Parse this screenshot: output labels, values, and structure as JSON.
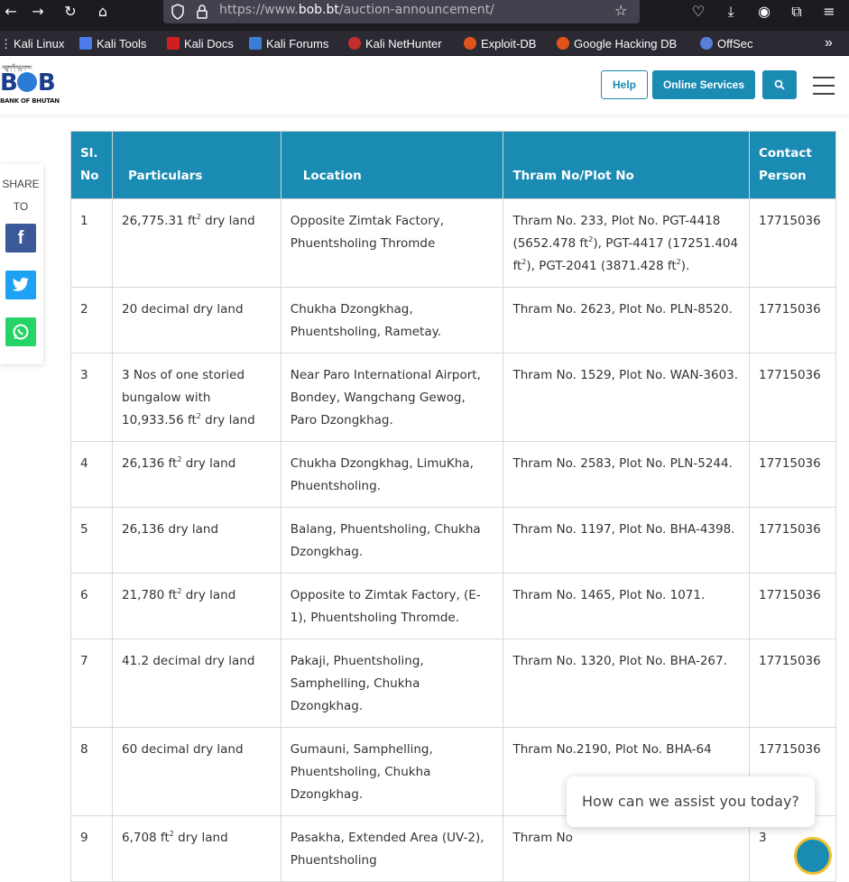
{
  "browser": {
    "url_prefix": "https://www.",
    "url_domain": "bob.bt",
    "url_path": "/auction-announcement/",
    "bookmarks": [
      {
        "label": "Kali Linux",
        "color": "#367bf0"
      },
      {
        "label": "Kali Tools",
        "color": "#4a7be8"
      },
      {
        "label": "Kali Docs",
        "color": "#d11f1f"
      },
      {
        "label": "Kali Forums",
        "color": "#3d7cd6"
      },
      {
        "label": "Kali NetHunter",
        "color": "#c22e2e"
      },
      {
        "label": "Exploit-DB",
        "color": "#e0541c"
      },
      {
        "label": "Google Hacking DB",
        "color": "#e0541c"
      },
      {
        "label": "OffSec",
        "color": "#5b7fd8"
      }
    ]
  },
  "site": {
    "logo_text": "BOB",
    "logo_sub": "BANK OF BHUTAN",
    "logo_top": "འབྲུག་གི་དངུལ་ཁང་",
    "help_label": "Help",
    "online_services_label": "Online Services",
    "brand_color": "#1a8bb3"
  },
  "share": {
    "label": "SHARE TO",
    "facebook_color": "#3b5998",
    "twitter_color": "#1da1f2",
    "whatsapp_color": "#25d366"
  },
  "table": {
    "headers": [
      "Sl. No",
      "Particulars",
      "Location",
      "Thram No/Plot No",
      "Contact Person"
    ],
    "rows": [
      {
        "no": "1",
        "particulars": "26,775.31 ft² dry land",
        "location": "Opposite Zimtak Factory, Phuentsholing Thromde",
        "thram": "Thram No. 233, Plot No. PGT-4418 (5652.478 ft²), PGT-4417 (17251.404 ft²), PGT-2041 (3871.428 ft²).",
        "contact": "17715036"
      },
      {
        "no": "2",
        "particulars": "20 decimal dry land",
        "location": "Chukha Dzongkhag, Phuentsholing, Rametay.",
        "thram": "Thram No. 2623, Plot No. PLN-8520.",
        "contact": "17715036"
      },
      {
        "no": "3",
        "particulars": "3 Nos of one storied bungalow with 10,933.56 ft² dry land",
        "location": "Near Paro International Airport, Bondey, Wangchang Gewog, Paro Dzongkhag.",
        "thram": "Thram No. 1529, Plot No. WAN-3603.",
        "contact": "17715036"
      },
      {
        "no": "4",
        "particulars": "26,136 ft² dry land",
        "location": "Chukha Dzongkhag, LimuKha, Phuentsholing.",
        "thram": "Thram No. 2583, Plot No. PLN-5244.",
        "contact": "17715036"
      },
      {
        "no": "5",
        "particulars": "26,136 dry land",
        "location": "Balang, Phuentsholing, Chukha Dzongkhag.",
        "thram": "Thram No. 1197, Plot No. BHA-4398.",
        "contact": "17715036"
      },
      {
        "no": "6",
        "particulars": "21,780 ft² dry land",
        "location": "Opposite to Zimtak Factory, (E-1), Phuentsholing Thromde.",
        "thram": "Thram No. 1465, Plot No. 1071.",
        "contact": "17715036"
      },
      {
        "no": "7",
        "particulars": "41.2 decimal dry land",
        "location": "Pakaji, Phuentsholing, Samphelling, Chukha Dzongkhag.",
        "thram": "Thram No. 1320, Plot No. BHA-267.",
        "contact": "17715036"
      },
      {
        "no": "8",
        "particulars": "60 decimal dry land",
        "location": "Gumauni, Samphelling, Phuentsholing, Chukha Dzongkhag.",
        "thram": "Thram No.2190, Plot No. BHA-64",
        "contact": "17715036"
      },
      {
        "no": "9",
        "particulars": "6,708 ft² dry land",
        "location": "Pasakha, Extended Area (UV-2), Phuentsholing",
        "thram": "Thram No",
        "contact": "3"
      }
    ]
  },
  "chat": {
    "prompt": "How can we assist you today?"
  }
}
